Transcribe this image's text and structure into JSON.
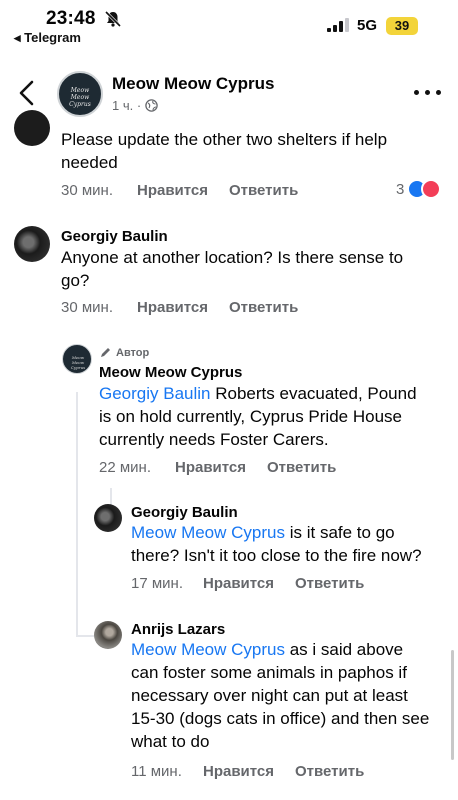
{
  "status_bar": {
    "time": "23:48",
    "back_app": "◂ Telegram",
    "network": "5G",
    "battery": "39"
  },
  "header": {
    "page_name": "Meow Meow Cyprus",
    "post_time": "1 ч. ·",
    "logo_text": "Meow Meow Cyprus"
  },
  "actions": {
    "like": "Нравится",
    "reply": "Ответить"
  },
  "comments": [
    {
      "text": "Please update the other two shelters if help needed",
      "time": "30 мин.",
      "reaction_count": "3"
    },
    {
      "author": "Georgiy Baulin",
      "text": "Anyone at another location? Is there sense to go?",
      "time": "30 мин."
    }
  ],
  "replies": [
    {
      "badge": "Автор",
      "author": "Meow Meow Cyprus",
      "mention": "Georgiy Baulin",
      "text": " Roberts evacuated, Pound is on hold currently, Cyprus Pride House currently needs Foster Carers.",
      "time": "22 мин."
    },
    {
      "author": "Georgiy Baulin",
      "mention": "Meow Meow Cyprus",
      "text": " is it safe to go there? Isn't it too close to the fire now?",
      "time": "17 мин."
    },
    {
      "author": "Anrijs Lazars",
      "mention": "Meow Meow Cyprus",
      "text": " as i said above can foster some animals in paphos if necessary over night can put at least 15-30 (dogs cats in office) and then see what to do",
      "time": "11 мин."
    }
  ],
  "colors": {
    "mention": "#1877f2",
    "meta": "#65676b",
    "battery": "#f3d43a"
  },
  "icons": [
    "bell-slash-icon",
    "signal-icon",
    "back-chevron-icon",
    "globe-icon",
    "more-icon",
    "pencil-icon",
    "like-reaction-icon",
    "love-reaction-icon"
  ]
}
